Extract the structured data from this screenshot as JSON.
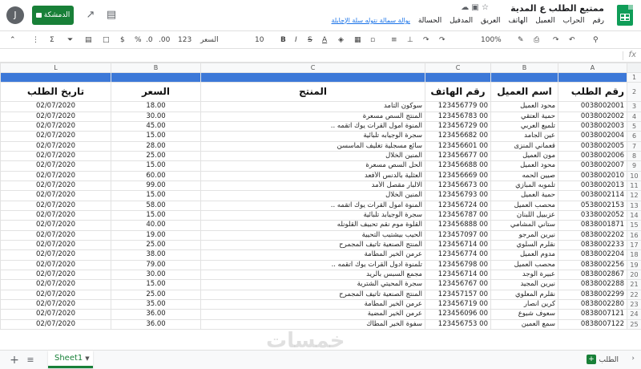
{
  "header": {
    "title": "ممتيع الطلب ع المدية",
    "avatar_letter": "J",
    "share_label": "الدمشكة",
    "menus": [
      "رقم",
      "الحراب",
      "العميل",
      "الهاتف",
      "العريق",
      "المدفيل",
      "الحسالة"
    ],
    "last_edit": "بوالة سمالة نتوله سلة الإجابلة"
  },
  "toolbar": {
    "zoom": "100%",
    "font": "السعر",
    "font_size": "10",
    "number_format": "123",
    "currency": "$",
    "percent": "%",
    "decimal_dec": ".0",
    "decimal_inc": ".00"
  },
  "columns": [
    "A",
    "B",
    "C",
    "C",
    "B",
    "L"
  ],
  "headers": [
    "رقم الطلب",
    "اسم العميل",
    "رقم الهاتف",
    "المنتج",
    "السعر",
    "تاريخ الطلب"
  ],
  "rows": [
    {
      "num": "3",
      "id": "0038002001",
      "name": "محود العميل",
      "phone": "00 123456779",
      "product": "سوكون التأمد",
      "price": "18.00",
      "date": "02/07/2020"
    },
    {
      "num": "4",
      "id": "0038002002",
      "name": "حمية العتقي",
      "phone": "00 123456783",
      "product": "المنتج السص مسعرة",
      "price": "30.00",
      "date": "02/07/2020"
    },
    {
      "num": "5",
      "id": "0038002003",
      "name": "تلميع العربي",
      "phone": "00 123456729",
      "product": "المنوة امول القرات يوك اتقمه ..",
      "price": "45.00",
      "date": "02/07/2020"
    },
    {
      "num": "6",
      "id": "0038002004",
      "name": "عين الجامد",
      "phone": "00 123456682",
      "product": "سجرة الوجيابه تلبائية",
      "price": "15.00",
      "date": "02/07/2020"
    },
    {
      "num": "7",
      "id": "0038002005",
      "name": "قعماني المنزى",
      "phone": "00 123456601",
      "product": "سائع مسجلية تغليف الماسسن",
      "price": "28.00",
      "date": "02/07/2020"
    },
    {
      "num": "8",
      "id": "0038002006",
      "name": "مون العميل",
      "phone": "00 123456677",
      "product": "المنين الخلال",
      "price": "25.00",
      "date": "02/07/2020"
    },
    {
      "num": "9",
      "id": "0038002007",
      "name": "محود العميل",
      "phone": "00 123456688",
      "product": "الحل السص مسعرة",
      "price": "15.00",
      "date": "02/07/2020"
    },
    {
      "num": "10",
      "id": "0038002010",
      "name": "صيين الحمه",
      "phone": "00 123456669",
      "product": "العثلية بالدنس الأفعد",
      "price": "60.00",
      "date": "02/07/2020"
    },
    {
      "num": "11",
      "id": "0038002013",
      "name": "تلموبه المبازي",
      "phone": "00 123456673",
      "product": "الالبار مقصل الأمد",
      "price": "99.00",
      "date": "02/07/2020"
    },
    {
      "num": "12",
      "id": "0038002114",
      "name": "حمية العميل",
      "phone": "00 123456793",
      "product": "المنين الخلال",
      "price": "15.00",
      "date": "02/07/2020"
    },
    {
      "num": "13",
      "id": "0538002153",
      "name": "محصب العميل",
      "phone": "00 123456724",
      "product": "المنوة امول القرات يوك اتقمه ..",
      "price": "58.00",
      "date": "02/07/2020"
    },
    {
      "num": "14",
      "id": "0338002052",
      "name": "عزبييل اللبنان",
      "phone": "00 123456787",
      "product": "سجرة الوجيابد تلبائية",
      "price": "15.00",
      "date": "02/07/2020"
    },
    {
      "num": "15",
      "id": "0838001871",
      "name": "ستاني المشامي",
      "phone": "00 123456888",
      "product": "القلوة موم نقم تحبيف القلونله",
      "price": "40.00",
      "date": "02/07/2020"
    },
    {
      "num": "16",
      "id": "0838002202",
      "name": "نيرين المرجو",
      "phone": "00 123457097",
      "product": "الحيب بيشتيب التحيية",
      "price": "19.00",
      "date": "02/07/2020"
    },
    {
      "num": "17",
      "id": "0838002233",
      "name": "نقلرم السلوي",
      "phone": "00 123456714",
      "product": "المنتج الصنعية تاتيف المجمرح",
      "price": "25.00",
      "date": "02/07/2020"
    },
    {
      "num": "18",
      "id": "0838002204",
      "name": "مدوم العميل",
      "phone": "00 123456774",
      "product": "عرمن الخير المطامة",
      "price": "38.00",
      "date": "02/07/2020"
    },
    {
      "num": "19",
      "id": "0838002256",
      "name": "محصب العميل",
      "phone": "00 123456798",
      "product": "تلمنوة ادول القرات يوك اتقمه ..",
      "price": "79.00",
      "date": "02/07/2020"
    },
    {
      "num": "20",
      "id": "0838002867",
      "name": "عبيرة الوجد",
      "phone": "00 123456714",
      "product": "مجمع السبس بالريد",
      "price": "30.00",
      "date": "02/07/2020"
    },
    {
      "num": "21",
      "id": "0838002288",
      "name": "نيرين المجيد",
      "phone": "00 123456767",
      "product": "سجرة المحيتي الشترية",
      "price": "15.00",
      "date": "02/07/2020"
    },
    {
      "num": "22",
      "id": "0838002299",
      "name": "نقلرم المعلوي",
      "phone": "00 123457157",
      "product": "المنتج الصنعية تاتيف المجمرح",
      "price": "25.00",
      "date": "02/07/2020"
    },
    {
      "num": "23",
      "id": "0838002280",
      "name": "كرين انصار",
      "phone": "00 123456719",
      "product": "عرمن الخير المطامة",
      "price": "35.00",
      "date": "02/07/2020"
    },
    {
      "num": "24",
      "id": "0838007121",
      "name": "سعوف شيوع",
      "phone": "00 123456096",
      "product": "عرمن الخير المضية",
      "price": "36.00",
      "date": "02/07/2020"
    },
    {
      "num": "25",
      "id": "0838007122",
      "name": "سمع العمين",
      "phone": "00 123456753",
      "product": "سفوة الخير المطاك",
      "price": "36.00",
      "date": "02/07/2020"
    }
  ],
  "bottom": {
    "sheet_name": "Sheet1",
    "explore_label": "الطلب",
    "watermark": "خمسات"
  },
  "colors": {
    "accent": "#188038",
    "header_band": "#3c78d8"
  }
}
